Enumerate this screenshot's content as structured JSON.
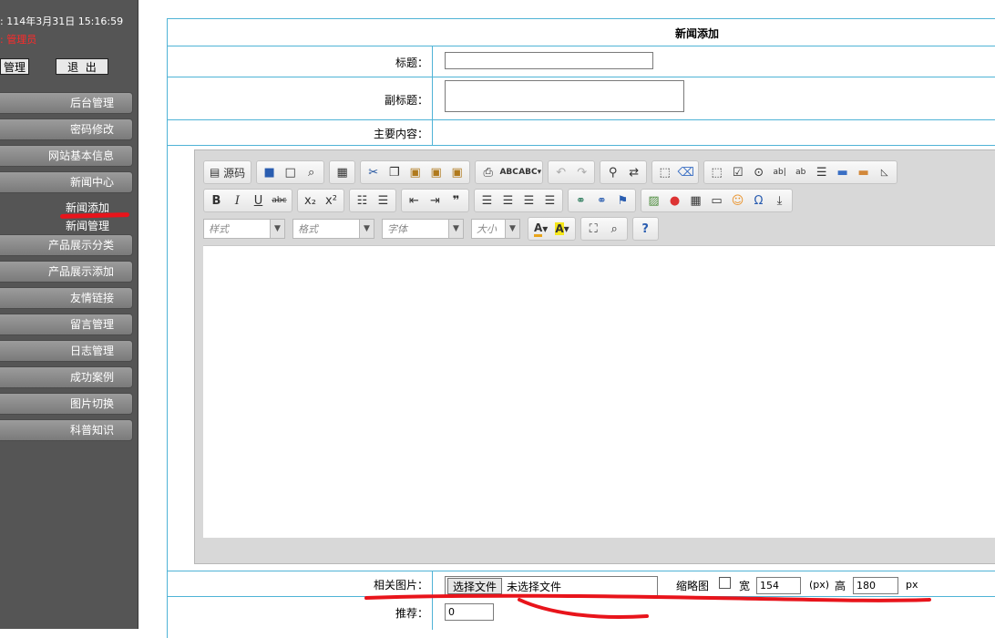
{
  "sidebar": {
    "date_line": ": 114年3月31日 15:16:59",
    "user_line": ": 管理员",
    "btn_manage": "管理",
    "btn_logout": "退  出",
    "menu": [
      {
        "label": "后台管理"
      },
      {
        "label": "密码修改"
      },
      {
        "label": "网站基本信息"
      },
      {
        "label": "新闻中心"
      }
    ],
    "sub": [
      {
        "label": "新闻添加"
      },
      {
        "label": "新闻管理"
      }
    ],
    "menu2": [
      {
        "label": "产品展示分类"
      },
      {
        "label": "产品展示添加"
      },
      {
        "label": "友情链接"
      },
      {
        "label": "留言管理"
      },
      {
        "label": "日志管理"
      },
      {
        "label": "成功案例"
      },
      {
        "label": "图片切换"
      },
      {
        "label": "科普知识"
      }
    ]
  },
  "form": {
    "title": "新闻添加",
    "label_title": "标题：",
    "label_subtitle": "副标题：",
    "label_content": "主要内容：",
    "label_image": "相关图片：",
    "label_recommend": "推荐：",
    "recommend_value": "0",
    "file_button": "选择文件",
    "file_status": "未选择文件",
    "thumb_label": "缩略图",
    "width_label": "宽",
    "width_value": "154",
    "px1": "(px)",
    "height_label": "高",
    "height_value": "180",
    "px2": "px"
  },
  "editor": {
    "source_label": "源码",
    "style_combo": "样式",
    "format_combo": "格式",
    "font_combo": "字体",
    "size_combo": "大小"
  },
  "colors": {
    "sidebar_bg": "#555555",
    "border_blue": "#4fb3d6",
    "annotation_red": "#e8141b"
  }
}
